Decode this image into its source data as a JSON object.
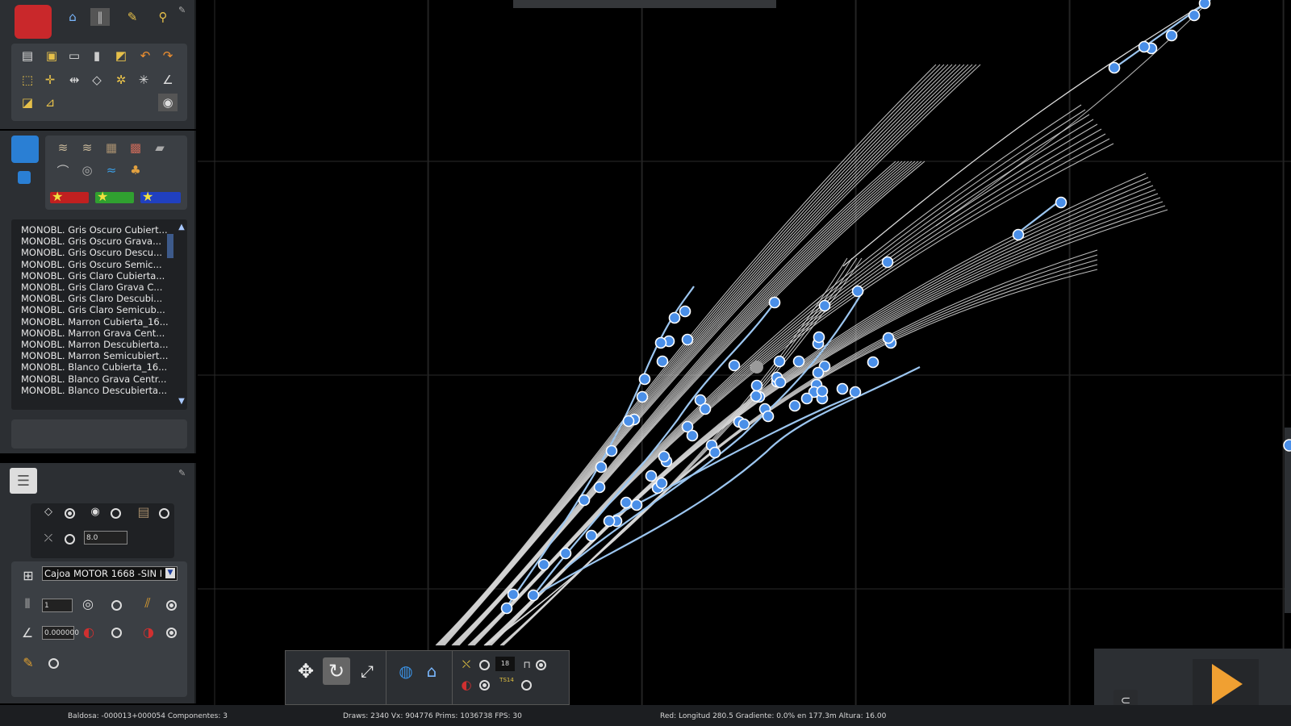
{
  "sidebar": {
    "material_list": [
      "MONOBL. Gris Oscuro Cubiert...",
      "MONOBL. Gris Oscuro Grava...",
      "MONOBL. Gris Oscuro Descu...",
      "MONOBL. Gris Oscuro Semic...",
      "MONOBL. Gris Claro Cubierta...",
      "MONOBL. Gris Claro Grava C...",
      "MONOBL. Gris Claro Descubi...",
      "MONOBL. Gris Claro Semicub...",
      "MONOBL. Marron Cubierta_16...",
      "MONOBL. Marron Grava Cent...",
      "MONOBL. Marron Descubierta...",
      "MONOBL. Marron Semicubiert...",
      "MONOBL. Blanco Cubierta_16...",
      "MONOBL. Blanco Grava Centr...",
      "MONOBL. Blanco Descubierta..."
    ],
    "track_width_value": "8.0",
    "rule_select_value": "Cajoa MOTOR 1668 -SIN I",
    "count_value": "1",
    "gradient_value": "0.000000"
  },
  "toolbar": {
    "counter_value": "18",
    "ts14_label": "TS14"
  },
  "status": {
    "tile": "Baldosa: -000013+000054  Componentes: 3",
    "stats": "Draws: 2340 Vx: 904776 Prims: 1036738 FPS: 30",
    "track_info": "Red:  Longitud  280.5 Gradiente:  0.0% en 177.3m Altura:  16.00"
  },
  "colors": {
    "node_blue": "#4a8fe8",
    "track_white": "#d9d9d9",
    "track_selected": "#9cc6f0",
    "grid": "#2a2a2a",
    "panel": "#2c2f33",
    "play_orange": "#f0a032"
  },
  "icons": {
    "toolbox": "toolbox-icon",
    "home": "home-icon",
    "play": "play-icon",
    "lock": "unlock-icon"
  }
}
